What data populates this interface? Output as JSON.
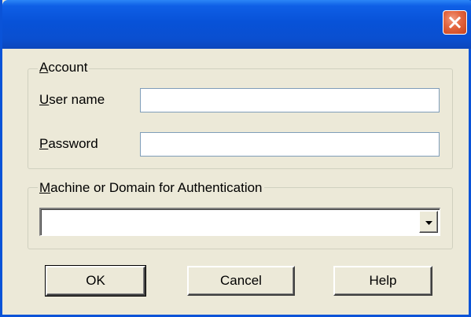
{
  "window": {
    "title": "",
    "close_icon": "close-icon",
    "titlebar_color": "#0A52D8",
    "close_color": "#D9532C"
  },
  "account_group": {
    "legend_first": "A",
    "legend_rest": "ccount",
    "username": {
      "label_first": "U",
      "label_rest": "ser name",
      "value": ""
    },
    "password": {
      "label_first": "P",
      "label_rest": "assword",
      "value": ""
    }
  },
  "domain_group": {
    "legend_first": "M",
    "legend_rest": "achine or Domain for Authentication",
    "selected_value": "",
    "dropdown_icon": "chevron-down-icon"
  },
  "buttons": {
    "ok": "OK",
    "cancel": "Cancel",
    "help": "Help"
  }
}
